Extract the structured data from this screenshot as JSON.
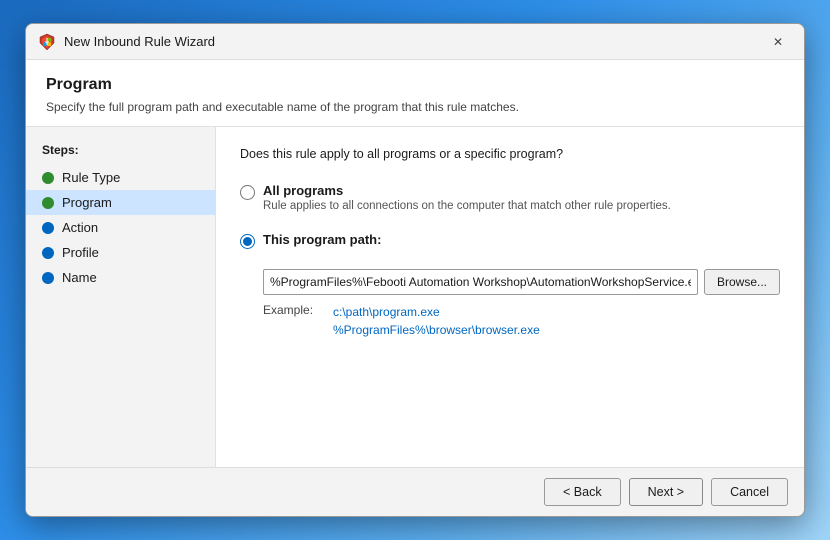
{
  "window": {
    "title": "New Inbound Rule Wizard",
    "icon": "shield-icon"
  },
  "header": {
    "title": "Program",
    "description": "Specify the full program path and executable name of the program that this rule matches."
  },
  "steps": {
    "label": "Steps:",
    "items": [
      {
        "id": "rule-type",
        "label": "Rule Type",
        "dot": "green",
        "active": false
      },
      {
        "id": "program",
        "label": "Program",
        "dot": "green",
        "active": true
      },
      {
        "id": "action",
        "label": "Action",
        "dot": "blue",
        "active": false
      },
      {
        "id": "profile",
        "label": "Profile",
        "dot": "blue",
        "active": false
      },
      {
        "id": "name",
        "label": "Name",
        "dot": "blue",
        "active": false
      }
    ]
  },
  "content": {
    "question": "Does this rule apply to all programs or a specific program?",
    "all_programs": {
      "label": "All programs",
      "sub": "Rule applies to all connections on the computer that match other rule properties."
    },
    "this_program": {
      "label": "This program path:",
      "path_value": "%ProgramFiles%\\Febooti Automation Workshop\\AutomationWorkshopService.exe",
      "browse_label": "Browse...",
      "example_label": "Example:",
      "example_value_line1": "c:\\path\\program.exe",
      "example_value_line2": "%ProgramFiles%\\browser\\browser.exe"
    }
  },
  "footer": {
    "back_label": "< Back",
    "next_label": "Next >",
    "cancel_label": "Cancel"
  }
}
